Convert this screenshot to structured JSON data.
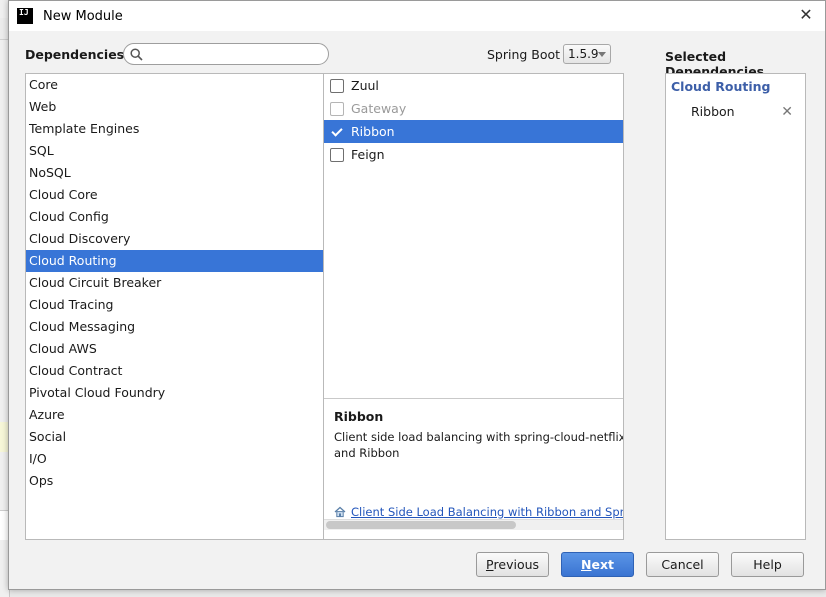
{
  "window": {
    "title": "New Module",
    "app_icon": "IJ"
  },
  "header": {
    "dependencies_label": "Dependencies",
    "search": {
      "value": "",
      "placeholder": ""
    },
    "spring_boot_label": "Spring Boot",
    "spring_boot_version": "1.5.9",
    "selected_title": "Selected Dependencies"
  },
  "categories": [
    "Core",
    "Web",
    "Template Engines",
    "SQL",
    "NoSQL",
    "Cloud Core",
    "Cloud Config",
    "Cloud Discovery",
    "Cloud Routing",
    "Cloud Circuit Breaker",
    "Cloud Tracing",
    "Cloud Messaging",
    "Cloud AWS",
    "Cloud Contract",
    "Pivotal Cloud Foundry",
    "Azure",
    "Social",
    "I/O",
    "Ops"
  ],
  "selected_category_index": 8,
  "dependencies": [
    {
      "label": "Zuul",
      "checked": false,
      "enabled": true,
      "selected": false
    },
    {
      "label": "Gateway",
      "checked": false,
      "enabled": false,
      "selected": false
    },
    {
      "label": "Ribbon",
      "checked": true,
      "enabled": true,
      "selected": true
    },
    {
      "label": "Feign",
      "checked": false,
      "enabled": true,
      "selected": false
    }
  ],
  "detail": {
    "title": "Ribbon",
    "description": "Client side load balancing with spring-cloud-netflix and Ribbon",
    "link_text": "Client Side Load Balancing with Ribbon and Spring Cloud"
  },
  "selected": {
    "group": "Cloud Routing",
    "items": [
      "Ribbon"
    ]
  },
  "buttons": {
    "previous_mnemonic": "P",
    "previous_rest": "revious",
    "next_mnemonic": "N",
    "next_rest": "ext",
    "cancel": "Cancel",
    "help": "Help"
  },
  "colors": {
    "selection": "#3875d7",
    "link": "#2255bb",
    "group_header": "#3d5fa8"
  }
}
